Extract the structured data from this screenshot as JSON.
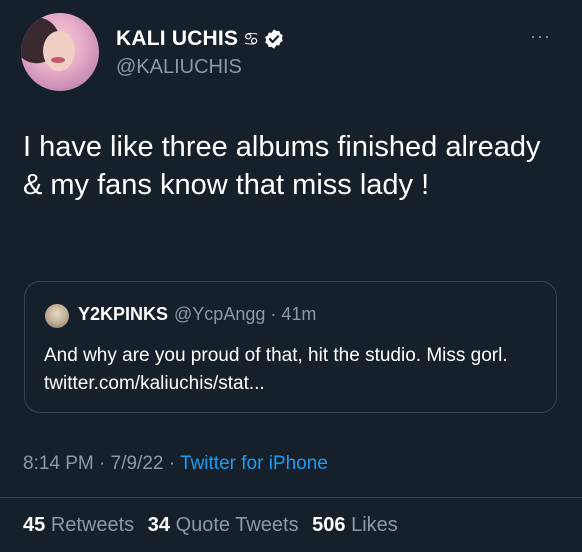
{
  "author": {
    "name": "KALI UCHIS",
    "name_emoji": "♋︎",
    "handle": "@KALIUCHIS",
    "verified": true
  },
  "more_label": "···",
  "tweet": {
    "text": "I have like three albums finished already & my fans know that miss lady !"
  },
  "quoted": {
    "name": "Y2KPINKS",
    "handle": "@YcpAngg · 41m",
    "text": "And why are you proud of that, hit the studio. Miss gorl. twitter.com/kaliuchis/stat..."
  },
  "meta": {
    "time": "8:14 PM · 7/9/22 · ",
    "source": "Twitter for iPhone"
  },
  "stats": {
    "retweets_count": "45",
    "retweets_label": "Retweets",
    "quotes_count": "34",
    "quotes_label": "Quote Tweets",
    "likes_count": "506",
    "likes_label": "Likes"
  },
  "colors": {
    "background": "#15202b",
    "text": "#ffffff",
    "secondary": "#8b98a5",
    "link": "#1d9bf0",
    "border": "#38444d"
  }
}
